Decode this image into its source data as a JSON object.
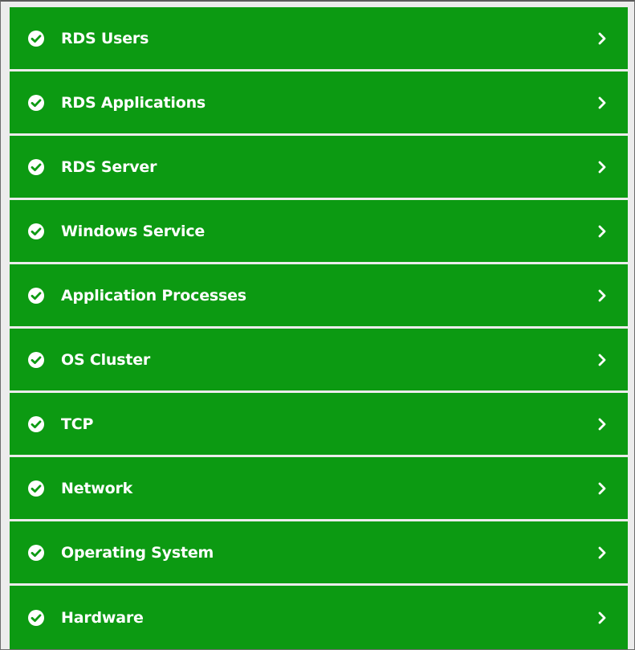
{
  "theme": {
    "row_color": "#0c9a12",
    "text_color": "#ffffff"
  },
  "icons": {
    "status": "check-circle-icon",
    "expand": "chevron-right-icon"
  },
  "layers": [
    {
      "label": "RDS Users"
    },
    {
      "label": "RDS Applications"
    },
    {
      "label": "RDS Server"
    },
    {
      "label": "Windows Service"
    },
    {
      "label": "Application Processes"
    },
    {
      "label": "OS Cluster"
    },
    {
      "label": "TCP"
    },
    {
      "label": "Network"
    },
    {
      "label": "Operating System"
    },
    {
      "label": "Hardware"
    }
  ]
}
